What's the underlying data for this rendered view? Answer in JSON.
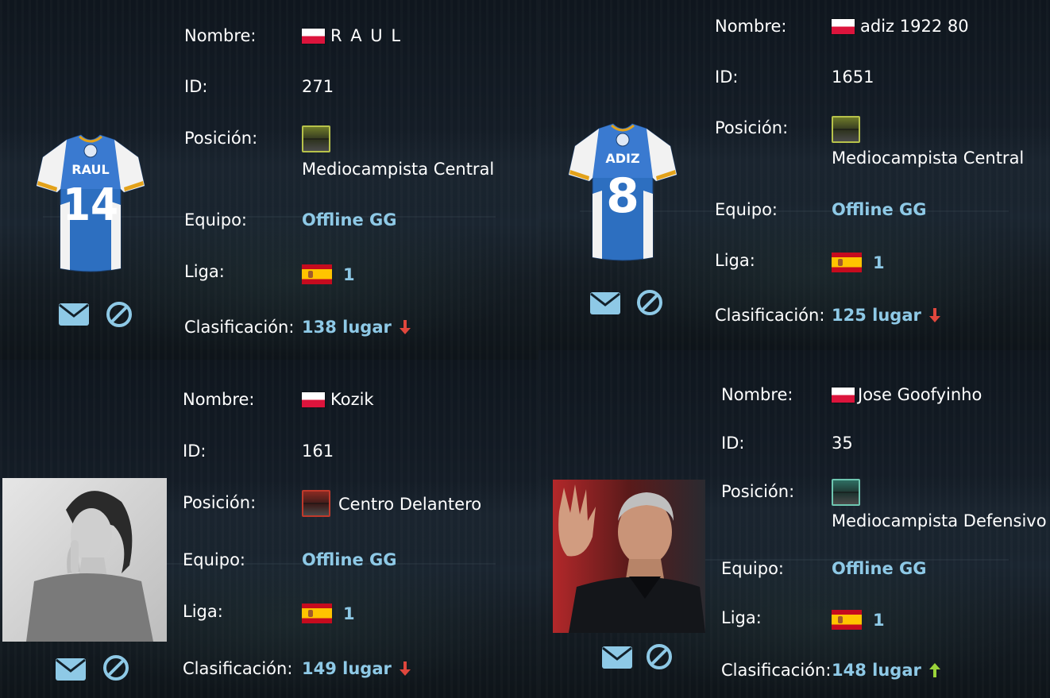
{
  "labels": {
    "name": "Nombre:",
    "id": "ID:",
    "position": "Posición:",
    "team": "Equipo:",
    "league": "Liga:",
    "ranking": "Clasificación:"
  },
  "colors": {
    "link": "#8ec9e6",
    "arrow_down": "#e0473d",
    "arrow_up": "#9bd43a",
    "icon": "#8ec9e6"
  },
  "players": [
    {
      "name": "R A U L",
      "nationality_flag": "poland-flag",
      "id": "271",
      "position": "Mediocampista Central",
      "position_icon": "position-midfield-icon",
      "team": "Offline GG",
      "league_flag": "spain-flag",
      "league": "1",
      "ranking": "138 lugar",
      "trend": "down",
      "avatar": "jersey",
      "jersey_name": "RAUL",
      "jersey_number": "14"
    },
    {
      "name": "adiz 1922 80",
      "nationality_flag": "poland-flag",
      "id": "1651",
      "position": "Mediocampista Central",
      "position_icon": "position-midfield-icon",
      "team": "Offline GG",
      "league_flag": "spain-flag",
      "league": "1",
      "ranking": "125 lugar",
      "trend": "down",
      "avatar": "jersey",
      "jersey_name": "ADIZ",
      "jersey_number": "8"
    },
    {
      "name": "Kozik",
      "nationality_flag": "poland-flag",
      "id": "161",
      "position": "Centro Delantero",
      "position_icon": "position-forward-icon",
      "team": "Offline GG",
      "league_flag": "spain-flag",
      "league": "1",
      "ranking": "149 lugar",
      "trend": "down",
      "avatar": "photo"
    },
    {
      "name": "Jose Goofyinho",
      "nationality_flag": "poland-flag",
      "id": "35",
      "position": "Mediocampista Defensivo",
      "position_icon": "position-defensive-midfield-icon",
      "team": "Offline GG",
      "league_flag": "spain-flag",
      "league": "1",
      "ranking": "148 lugar",
      "trend": "up",
      "avatar": "photo"
    }
  ]
}
